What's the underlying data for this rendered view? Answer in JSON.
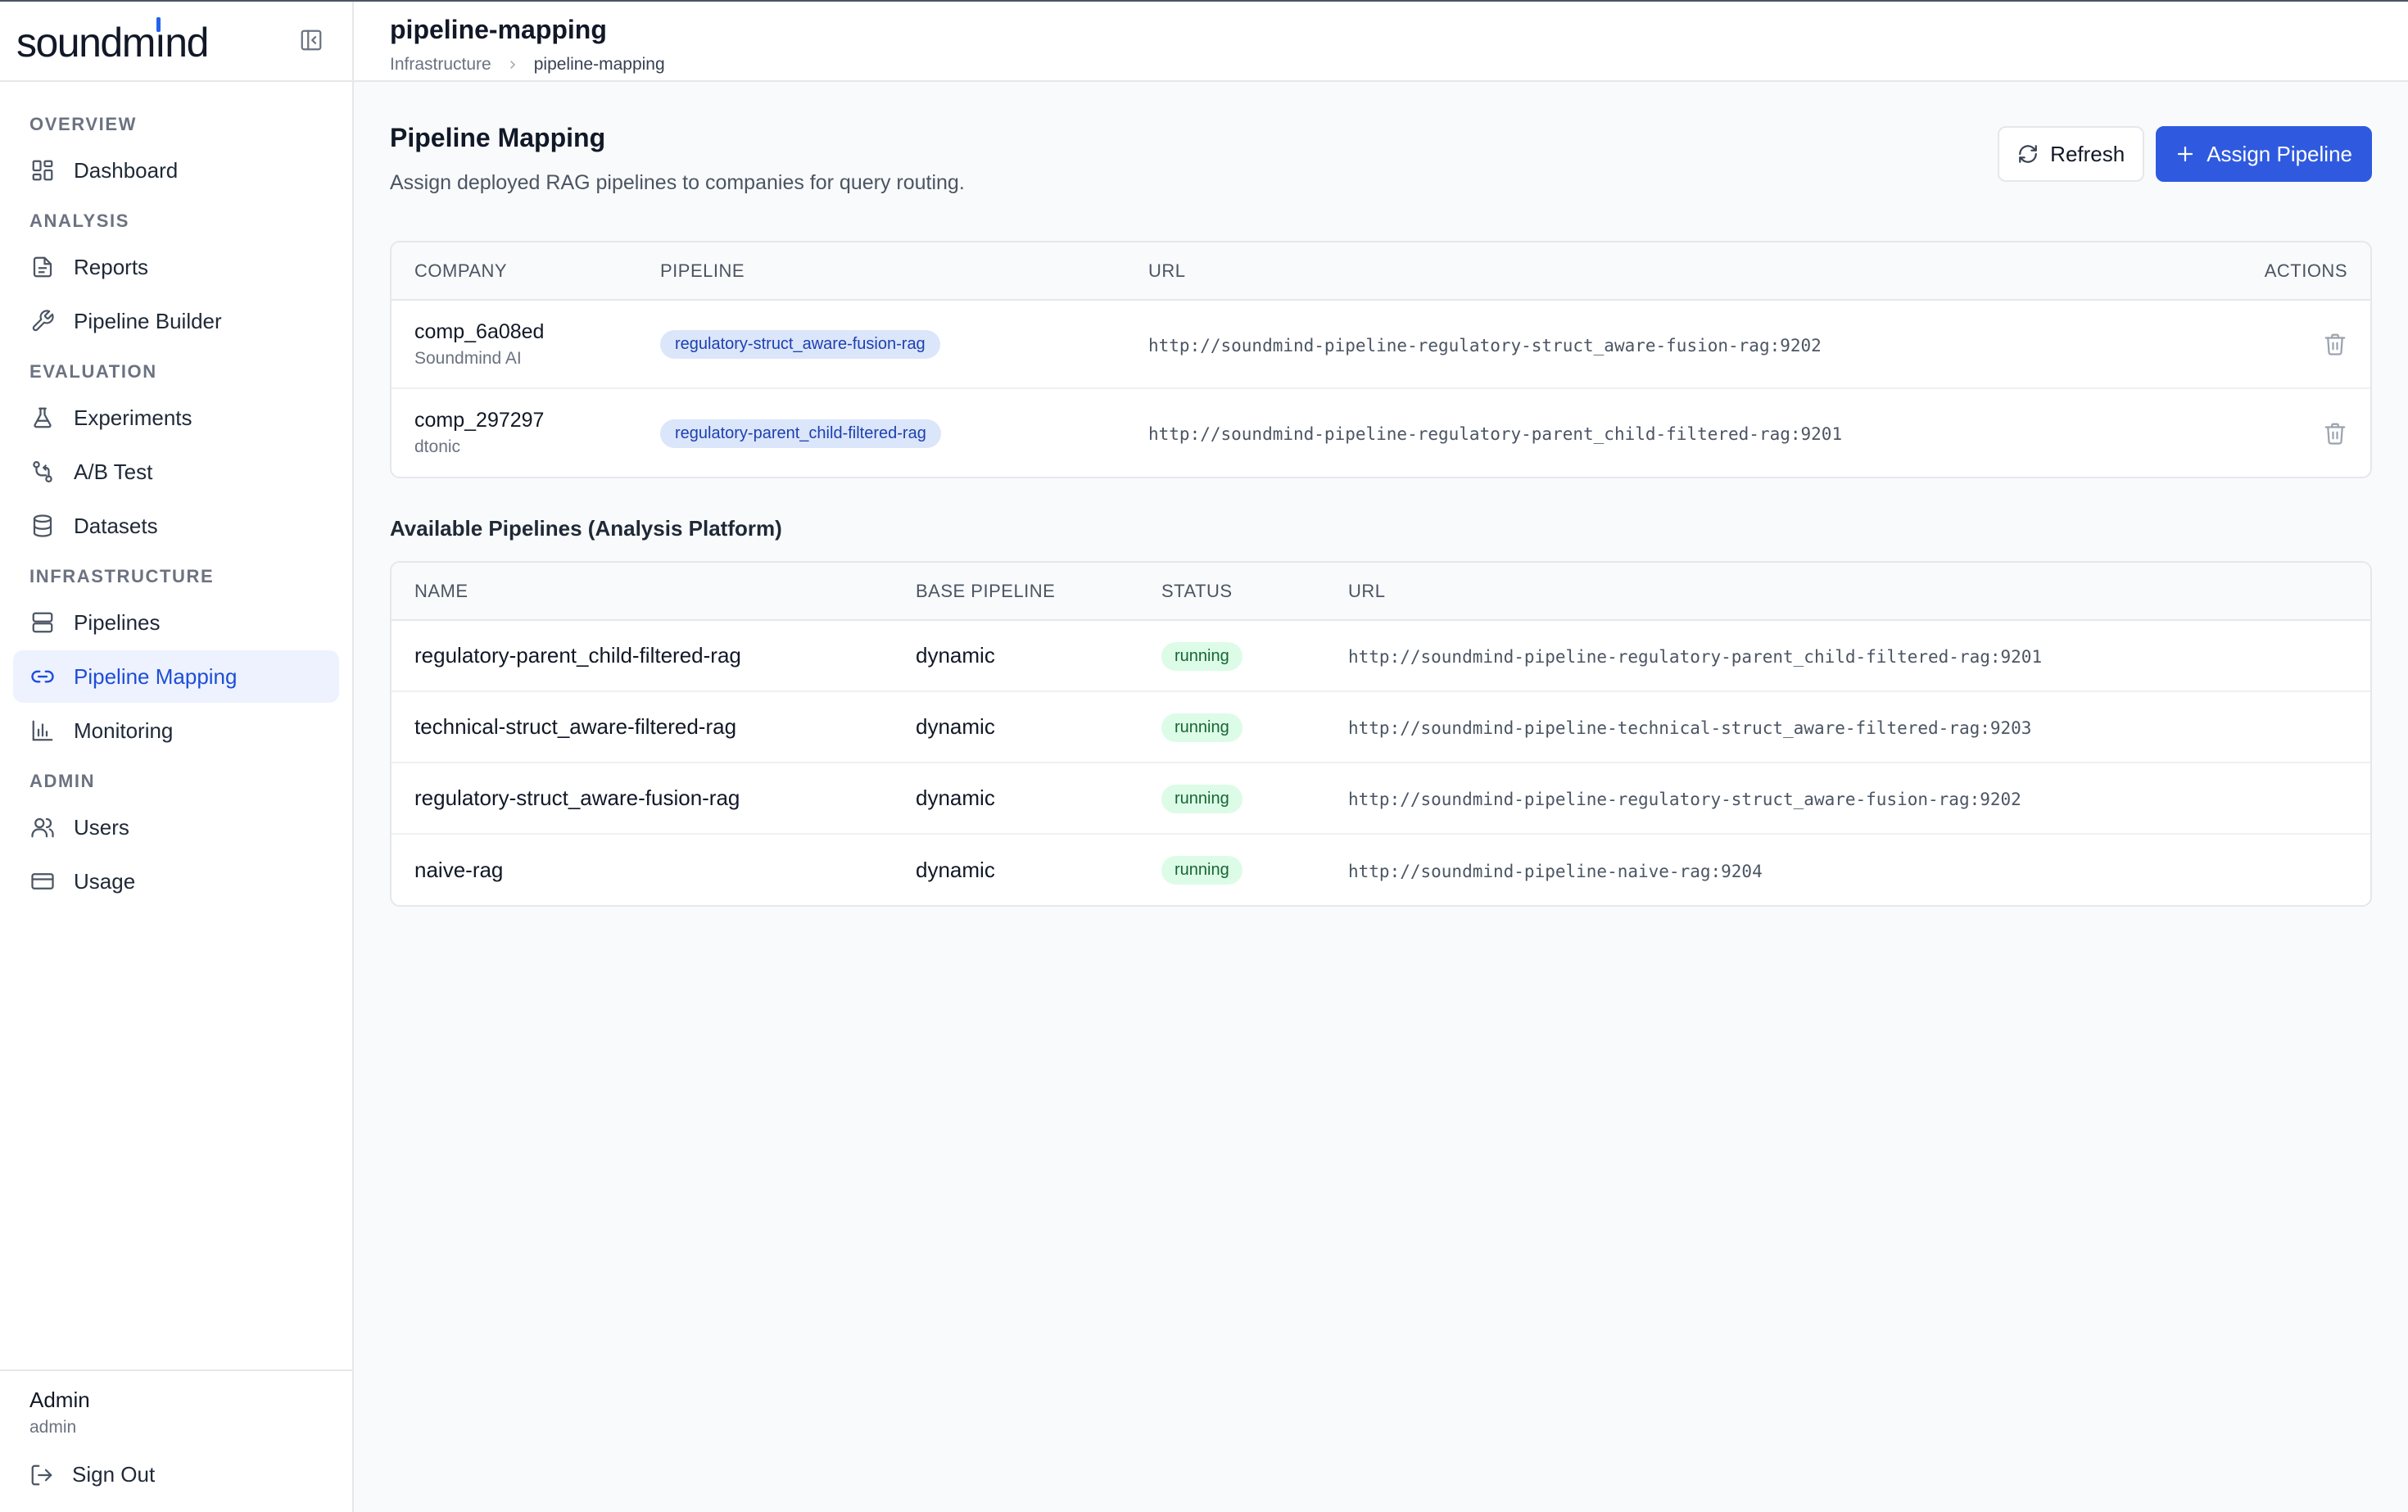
{
  "brand": {
    "name_prefix": "soundm",
    "name_accent": "ı",
    "name_suffix": "nd",
    "accent_color": "#2563eb"
  },
  "sidebar": {
    "sections": [
      {
        "title": "OVERVIEW",
        "items": [
          {
            "label": "Dashboard",
            "icon": "dashboard-icon"
          }
        ]
      },
      {
        "title": "ANALYSIS",
        "items": [
          {
            "label": "Reports",
            "icon": "report-icon"
          },
          {
            "label": "Pipeline Builder",
            "icon": "wrench-icon"
          }
        ]
      },
      {
        "title": "EVALUATION",
        "items": [
          {
            "label": "Experiments",
            "icon": "flask-icon"
          },
          {
            "label": "A/B Test",
            "icon": "branch-icon"
          },
          {
            "label": "Datasets",
            "icon": "database-icon"
          }
        ]
      },
      {
        "title": "INFRASTRUCTURE",
        "items": [
          {
            "label": "Pipelines",
            "icon": "server-icon"
          },
          {
            "label": "Pipeline Mapping",
            "icon": "link-icon",
            "active": true
          },
          {
            "label": "Monitoring",
            "icon": "bar-chart-icon"
          }
        ]
      },
      {
        "title": "ADMIN",
        "items": [
          {
            "label": "Users",
            "icon": "users-icon"
          },
          {
            "label": "Usage",
            "icon": "card-icon"
          }
        ]
      }
    ],
    "user": {
      "name": "Admin",
      "role": "admin"
    },
    "signout_label": "Sign Out"
  },
  "header": {
    "title": "pipeline-mapping",
    "breadcrumb": [
      "Infrastructure",
      "pipeline-mapping"
    ]
  },
  "page": {
    "title": "Pipeline Mapping",
    "subtitle": "Assign deployed RAG pipelines to companies for query routing.",
    "refresh_label": "Refresh",
    "assign_label": "Assign Pipeline",
    "primary_color": "#2f5ae0"
  },
  "mappings": {
    "columns": [
      "COMPANY",
      "PIPELINE",
      "URL",
      "ACTIONS"
    ],
    "rows": [
      {
        "company_id": "comp_6a08ed",
        "company_name": "Soundmind AI",
        "pipeline": "regulatory-struct_aware-fusion-rag",
        "url": "http://soundmind-pipeline-regulatory-struct_aware-fusion-rag:9202"
      },
      {
        "company_id": "comp_297297",
        "company_name": "dtonic",
        "pipeline": "regulatory-parent_child-filtered-rag",
        "url": "http://soundmind-pipeline-regulatory-parent_child-filtered-rag:9201"
      }
    ]
  },
  "available": {
    "title": "Available Pipelines (Analysis Platform)",
    "columns": [
      "NAME",
      "BASE PIPELINE",
      "STATUS",
      "URL"
    ],
    "rows": [
      {
        "name": "regulatory-parent_child-filtered-rag",
        "base": "dynamic",
        "status": "running",
        "url": "http://soundmind-pipeline-regulatory-parent_child-filtered-rag:9201"
      },
      {
        "name": "technical-struct_aware-filtered-rag",
        "base": "dynamic",
        "status": "running",
        "url": "http://soundmind-pipeline-technical-struct_aware-filtered-rag:9203"
      },
      {
        "name": "regulatory-struct_aware-fusion-rag",
        "base": "dynamic",
        "status": "running",
        "url": "http://soundmind-pipeline-regulatory-struct_aware-fusion-rag:9202"
      },
      {
        "name": "naive-rag",
        "base": "dynamic",
        "status": "running",
        "url": "http://soundmind-pipeline-naive-rag:9204"
      }
    ]
  }
}
